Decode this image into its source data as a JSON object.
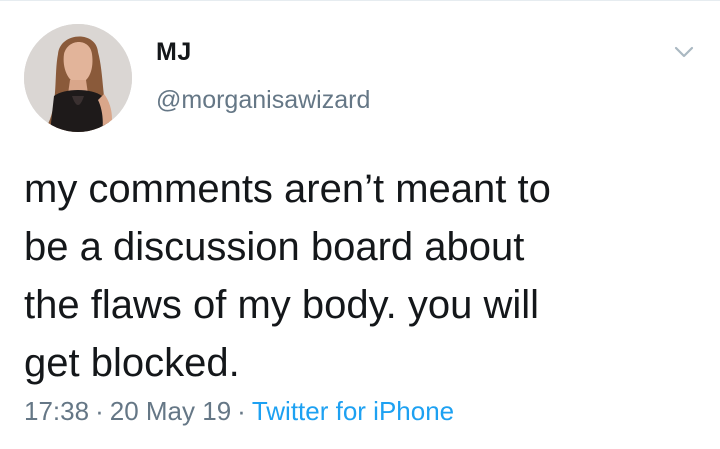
{
  "user": {
    "display_name": "MJ",
    "handle": "@morganisawizard"
  },
  "tweet": {
    "lines": [
      "my comments aren’t meant to",
      "be a discussion board about",
      "the flaws of my body. you will",
      "get blocked."
    ]
  },
  "meta": {
    "time": "17:38",
    "separator": "·",
    "date": "20 May 19",
    "source": "Twitter for iPhone"
  },
  "colors": {
    "text": "#14171a",
    "secondary": "#657786",
    "link": "#1da1f2"
  },
  "icons": {
    "menu": "chevron-down-icon"
  }
}
